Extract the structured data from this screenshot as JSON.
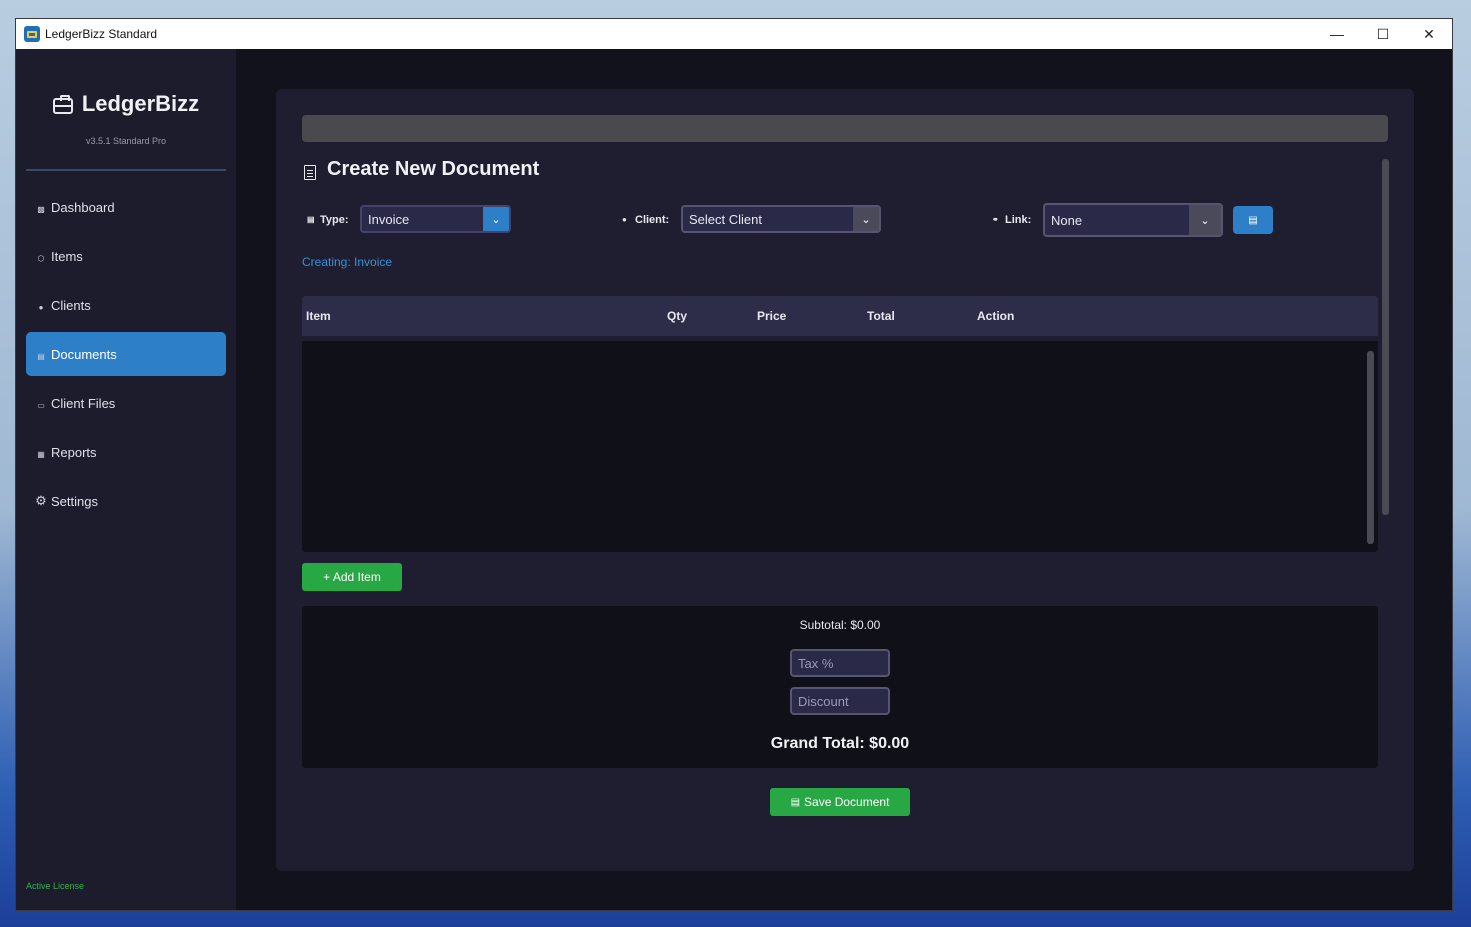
{
  "window": {
    "title": "LedgerBizz Standard"
  },
  "sidebar": {
    "brand": "LedgerBizz",
    "version": "v3.5.1 Standard Pro",
    "items": [
      {
        "label": "Dashboard",
        "icon": "chart-icon"
      },
      {
        "label": "Items",
        "icon": "box-icon"
      },
      {
        "label": "Clients",
        "icon": "users-icon"
      },
      {
        "label": "Documents",
        "icon": "document-icon",
        "active": true
      },
      {
        "label": "Client Files",
        "icon": "folder-icon"
      },
      {
        "label": "Reports",
        "icon": "report-icon"
      },
      {
        "label": "Settings",
        "icon": "gear-icon"
      }
    ],
    "license": "Active License"
  },
  "main": {
    "title": "Create New Document",
    "type_label": "Type:",
    "type_value": "Invoice",
    "client_label": "Client:",
    "client_value": "Select Client",
    "link_label": "Link:",
    "link_value": "None",
    "creating_text": "Creating: Invoice",
    "table_headers": [
      "Item",
      "Qty",
      "Price",
      "Total",
      "Action"
    ],
    "add_item_label": "+ Add Item",
    "subtotal": "Subtotal: $0.00",
    "tax_placeholder": "Tax %",
    "discount_placeholder": "Discount",
    "grand_total": "Grand Total: $0.00",
    "save_label": "Save Document"
  },
  "colors": {
    "accent": "#2d80c8",
    "success": "#28a745",
    "sidebar_bg": "#1c1c2c",
    "panel_bg": "#1e1e30"
  }
}
